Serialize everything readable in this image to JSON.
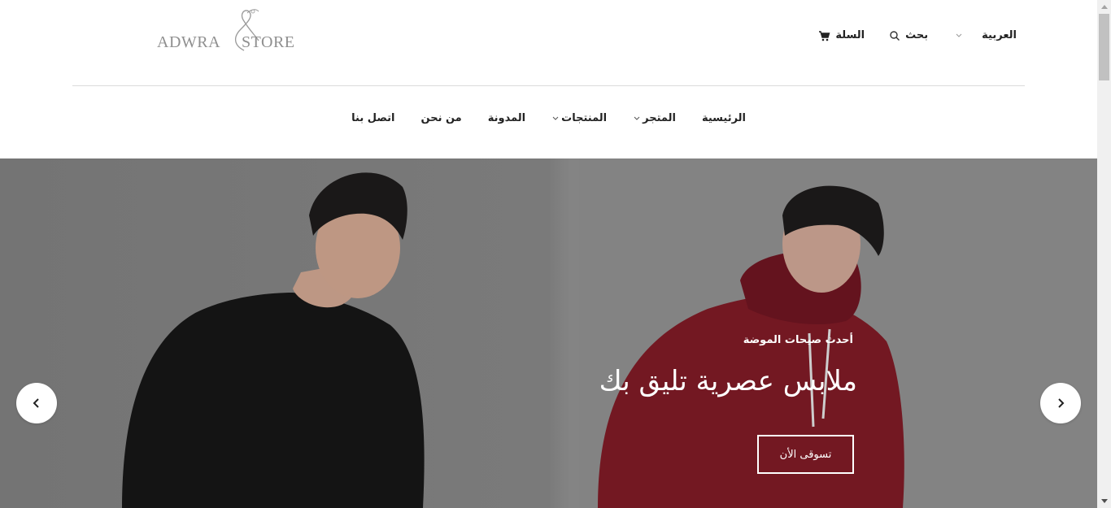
{
  "brand": {
    "left": "ADWRA",
    "right": "STORE"
  },
  "topbar": {
    "language": "العربية",
    "search": "بحث",
    "cart": "السلة"
  },
  "nav": {
    "items": [
      {
        "label": "الرئيسية",
        "has_dropdown": false
      },
      {
        "label": "المتجر",
        "has_dropdown": true
      },
      {
        "label": "المنتجات",
        "has_dropdown": true
      },
      {
        "label": "المدونة",
        "has_dropdown": false
      },
      {
        "label": "من نحن",
        "has_dropdown": false
      },
      {
        "label": "اتصل بنا",
        "has_dropdown": false
      }
    ]
  },
  "hero": {
    "subtitle": "أحدث صيحات الموضة",
    "title": "ملابس عصرية تليق بك",
    "button": "تسوقى الأن"
  },
  "colors": {
    "hoodie": "#7a1a24",
    "shirt": "#161616",
    "hero_bg": "#818181"
  },
  "icons": {
    "prev": "chevron-left-icon",
    "next": "chevron-right-icon",
    "search": "search-icon",
    "cart": "cart-icon",
    "language_dropdown": "chevron-down-icon"
  }
}
